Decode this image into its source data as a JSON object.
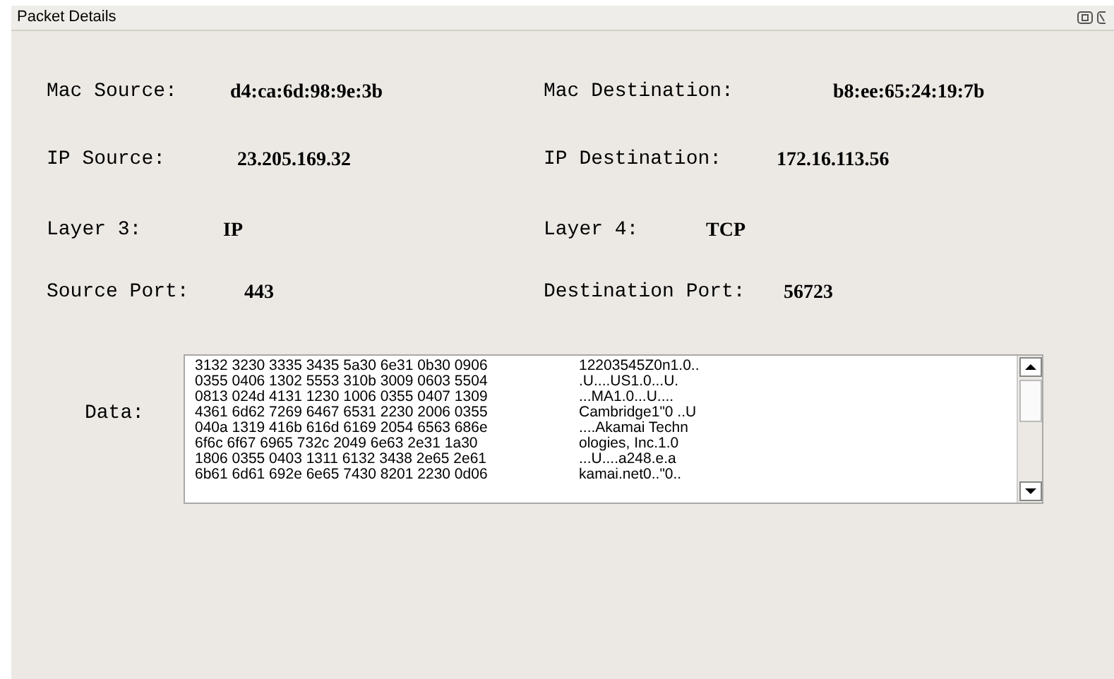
{
  "window": {
    "title": "Packet Details"
  },
  "fields": [
    {
      "label": "Mac Source:",
      "value": "d4:ca:6d:98:9e:3b"
    },
    {
      "label": "Mac Destination:",
      "value": "b8:ee:65:24:19:7b"
    },
    {
      "label": "IP Source:",
      "value": "23.205.169.32"
    },
    {
      "label": "IP Destination:",
      "value": "172.16.113.56"
    },
    {
      "label": "Layer 3:",
      "value": "IP"
    },
    {
      "label": "Layer 4:",
      "value": "TCP"
    },
    {
      "label": "Source Port:",
      "value": "443"
    },
    {
      "label": "Destination Port:",
      "value": "56723"
    }
  ],
  "data": {
    "label": "Data:",
    "rows": [
      {
        "hex": "3132 3230 3335 3435 5a30 6e31 0b30 0906",
        "ascii": "12203545Z0n1.0.."
      },
      {
        "hex": "0355 0406 1302 5553 310b 3009 0603 5504",
        "ascii": ".U....US1.0...U."
      },
      {
        "hex": "0813 024d 4131 1230 1006 0355 0407 1309",
        "ascii": "...MA1.0...U...."
      },
      {
        "hex": "4361 6d62 7269 6467 6531 2230 2006 0355",
        "ascii": "Cambridge1\"0 ..U"
      },
      {
        "hex": "040a 1319 416b 616d 6169 2054 6563 686e",
        "ascii": "....Akamai Techn"
      },
      {
        "hex": "6f6c 6f67 6965 732c 2049 6e63 2e31 1a30",
        "ascii": "ologies, Inc.1.0"
      },
      {
        "hex": "1806 0355 0403 1311 6132 3438 2e65 2e61",
        "ascii": "...U....a248.e.a"
      },
      {
        "hex": "6b61 6d61 692e 6e65 7430 8201 2230 0d06",
        "ascii": "kamai.net0..\"0.."
      }
    ]
  }
}
